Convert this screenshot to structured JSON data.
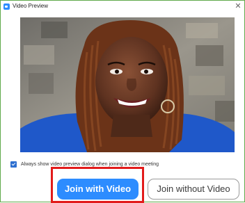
{
  "window": {
    "title": "Video Preview",
    "close_glyph": "✕",
    "border_color": "#5fa94a"
  },
  "preview": {
    "description_icon": "camera-preview"
  },
  "preference": {
    "checked": true,
    "label": "Always show video preview dialog when joining a video meeting"
  },
  "actions": {
    "join_with_video": "Join with Video",
    "join_without_video": "Join without Video",
    "primary_color": "#2d8cff",
    "highlight_color": "#e21b1b"
  }
}
